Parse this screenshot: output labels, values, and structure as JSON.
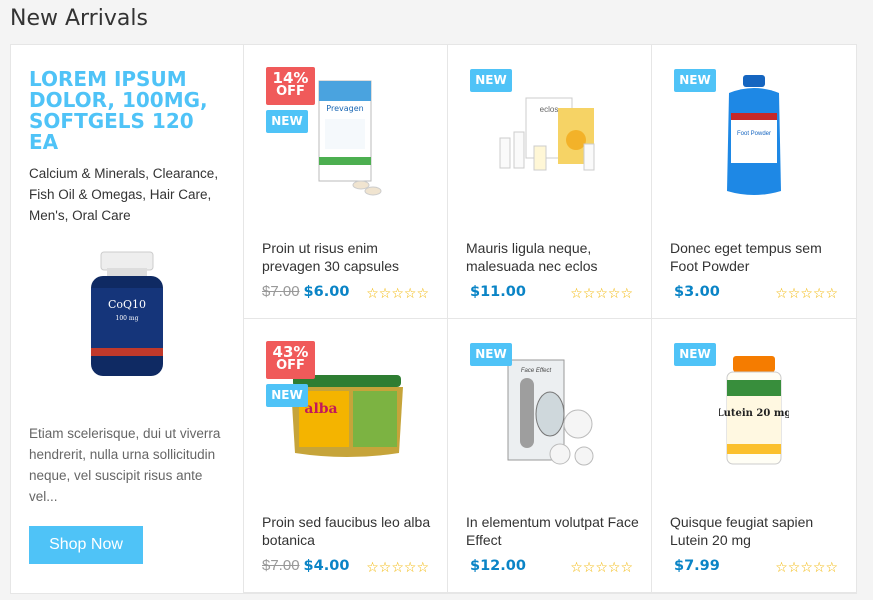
{
  "section": {
    "title": "New Arrivals"
  },
  "featured": {
    "title": "LOREM IPSUM DOLOR, 100MG, SOFTGELS 120 EA",
    "categories": "Calcium & Minerals, Clearance, Fish Oil & Omegas, Hair Care, Men's, Oral Care",
    "image_label": "CoQ10",
    "image_sub": "100 mg",
    "description": "Etiam scelerisque, dui ut viverra hendrerit, nulla urna sollicitudin neque, vel suscipit risus ante vel...",
    "button": "Shop Now"
  },
  "products": [
    {
      "name": "Proin ut risus enim prevagen 30 capsules",
      "old_price": "$7.00",
      "price": "$6.00",
      "sale": "14%",
      "sale_off": "OFF",
      "new": "NEW",
      "stars": "☆☆☆☆☆",
      "image_label": "Prevagen"
    },
    {
      "name": "Mauris ligula neque, malesuada nec eclos",
      "old_price": "",
      "price": "$11.00",
      "sale": "",
      "sale_off": "",
      "new": "NEW",
      "stars": "☆☆☆☆☆",
      "image_label": "eclos"
    },
    {
      "name": "Donec eget tempus sem Foot Powder",
      "old_price": "",
      "price": "$3.00",
      "sale": "",
      "sale_off": "",
      "new": "NEW",
      "stars": "☆☆☆☆☆",
      "image_label": "Foot Powder"
    },
    {
      "name": "Proin sed faucibus leo alba botanica",
      "old_price": "$7.00",
      "price": "$4.00",
      "sale": "43%",
      "sale_off": "OFF",
      "new": "NEW",
      "stars": "☆☆☆☆☆",
      "image_label": "alba"
    },
    {
      "name": "In elementum volutpat Face Effect",
      "old_price": "",
      "price": "$12.00",
      "sale": "",
      "sale_off": "",
      "new": "NEW",
      "stars": "☆☆☆☆☆",
      "image_label": "Face Effect"
    },
    {
      "name": "Quisque feugiat sapien Lutein 20 mg",
      "old_price": "",
      "price": "$7.99",
      "sale": "",
      "sale_off": "",
      "new": "NEW",
      "stars": "☆☆☆☆☆",
      "image_label": "Lutein 20 mg"
    }
  ],
  "colors": {
    "accent": "#4fc3f7",
    "sale": "#f05a5a",
    "price": "#0a84c6",
    "star": "#f2b600"
  }
}
